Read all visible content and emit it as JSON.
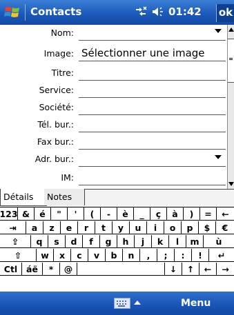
{
  "titlebar": {
    "app_title": "Contacts",
    "time": "01:42",
    "ok_label": "ok",
    "connectivity_icon": "connectivity-icon",
    "volume_icon": "speaker-icon"
  },
  "form": {
    "fields": [
      {
        "label": "Nom:",
        "value": "",
        "dropdown": true
      },
      {
        "label": "Image:",
        "value": "Sélectionner une image",
        "dropdown": false
      },
      {
        "label": "Titre:",
        "value": "",
        "dropdown": false
      },
      {
        "label": "Service:",
        "value": "",
        "dropdown": false
      },
      {
        "label": "Société:",
        "value": "",
        "dropdown": false
      },
      {
        "label": "Tél. bur.:",
        "value": "",
        "dropdown": false
      },
      {
        "label": "Fax bur.:",
        "value": "",
        "dropdown": false
      },
      {
        "label": "Adr. bur.:",
        "value": "",
        "dropdown": true
      },
      {
        "label": "IM:",
        "value": "",
        "dropdown": false
      }
    ]
  },
  "tabs": [
    {
      "label": "Détails",
      "active": true
    },
    {
      "label": "Notes",
      "active": false
    }
  ],
  "keyboard": {
    "rows": [
      [
        "123",
        "&",
        "é",
        "\"",
        "'",
        "(",
        "-",
        "è",
        "_",
        "ç",
        "à",
        ")",
        "=",
        "←"
      ],
      [
        "⇥",
        "a",
        "z",
        "e",
        "r",
        "t",
        "y",
        "u",
        "i",
        "o",
        "p",
        "$",
        "€"
      ],
      [
        "⇪",
        "q",
        "s",
        "d",
        "f",
        "g",
        "h",
        "j",
        "k",
        "l",
        "m",
        "ù"
      ],
      [
        "⇧",
        "w",
        "x",
        "c",
        "v",
        "b",
        "n",
        ",",
        ";",
        ":",
        "!",
        "↵"
      ],
      [
        "Ctl",
        "áë",
        "*",
        "@",
        " ",
        "↓",
        "↑",
        "←",
        "→"
      ]
    ]
  },
  "menubar": {
    "menu_label": "Menu",
    "keyboard_icon": "keyboard-icon"
  },
  "colors": {
    "bar_blue": "#1a57b8",
    "ok_bg": "#0f3f8f"
  }
}
